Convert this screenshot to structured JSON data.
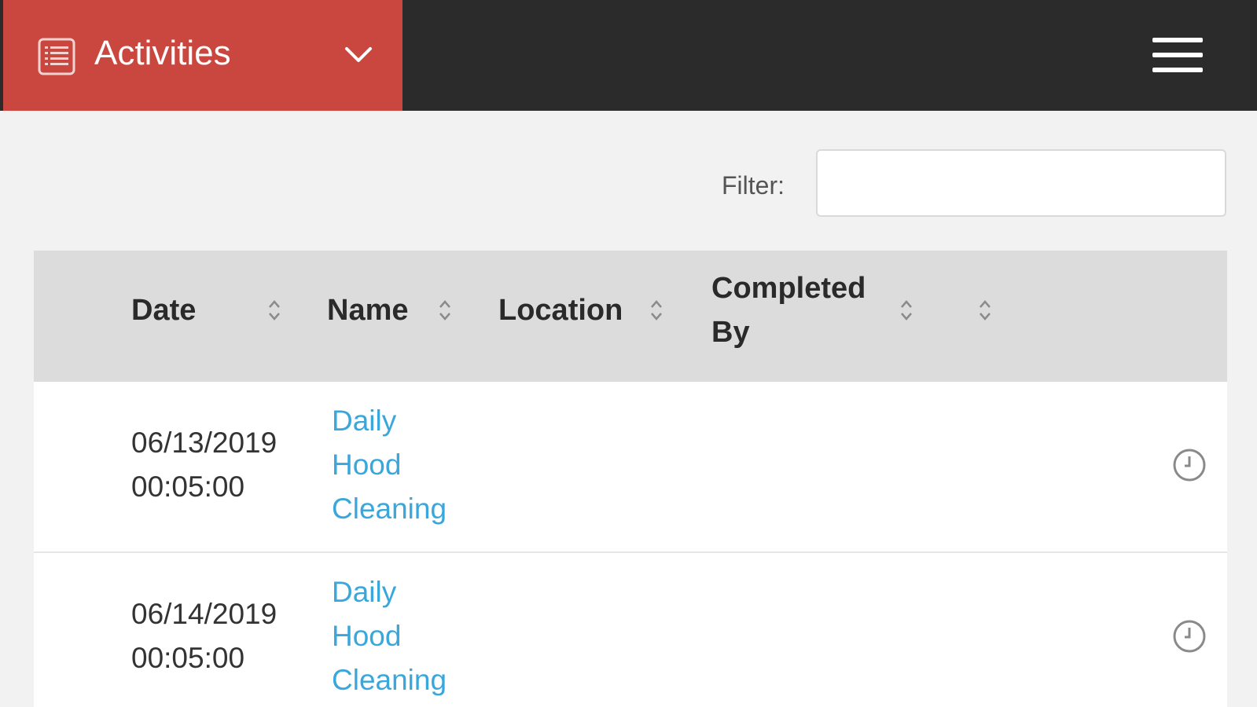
{
  "header": {
    "module_label": "Activities",
    "module_icon": "list-document-icon",
    "menu_icon": "hamburger-menu-icon",
    "brand_color": "#c9473f"
  },
  "filter": {
    "label": "Filter:",
    "value": "",
    "placeholder": ""
  },
  "table": {
    "columns": [
      {
        "key": "date",
        "label": "Date"
      },
      {
        "key": "name",
        "label": "Name"
      },
      {
        "key": "location",
        "label": "Location"
      },
      {
        "key": "completed_by",
        "label_line1": "Completed",
        "label_line2": "By"
      },
      {
        "key": "actions",
        "label": ""
      }
    ],
    "rows": [
      {
        "date_line1": "06/13/2019",
        "date_line2": "00:05:00",
        "name_line1": "Daily",
        "name_line2": "Hood",
        "name_line3": "Cleaning",
        "location": "",
        "completed_by": "",
        "action_icon": "clock-icon"
      },
      {
        "date_line1": "06/14/2019",
        "date_line2": "00:05:00",
        "name_line1": "Daily",
        "name_line2": "Hood",
        "name_line3": "Cleaning",
        "location": "",
        "completed_by": "",
        "action_icon": "clock-icon"
      }
    ]
  },
  "colors": {
    "topbar": "#2b2b2b",
    "link": "#39a7dc",
    "table_header": "#dcdcdc"
  }
}
